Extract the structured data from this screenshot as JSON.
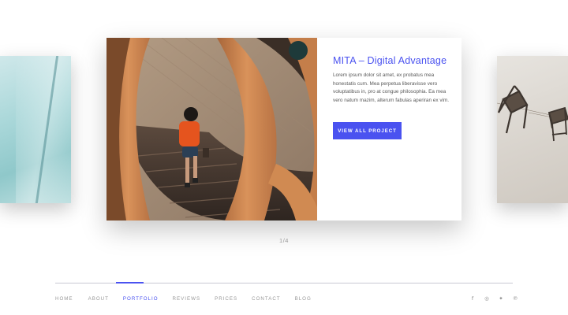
{
  "slider": {
    "title": "MITA – Digital Advantage",
    "description": "Lorem ipsum dolor sit amet, ex probatus mea honestatis cum. Mea perpetua liberavisse vero voluptatibus in, pro at congue philosophia. Ea mea vero natum mazim, alterum fabulas aperiran ex vim.",
    "button_label": "VIEW ALL PROJECT",
    "counter": "1/4"
  },
  "footer": {
    "nav": [
      "HOME",
      "ABOUT",
      "PORTFOLIO",
      "REVIEWS",
      "PRICES",
      "CONTACT",
      "BLOG"
    ],
    "active_nav": "PORTFOLIO",
    "social": [
      {
        "icon": "facebook-icon",
        "glyph": "f"
      },
      {
        "icon": "instagram-icon",
        "glyph": "◎"
      },
      {
        "icon": "twitter-icon",
        "glyph": "✦"
      },
      {
        "icon": "pinterest-icon",
        "glyph": "℗"
      }
    ]
  },
  "colors": {
    "accent": "#4a52f0",
    "text_muted": "#999999"
  }
}
